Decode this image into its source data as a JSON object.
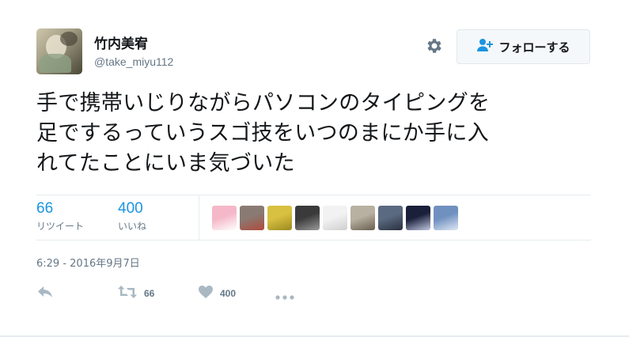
{
  "user": {
    "display_name": "竹内美宥",
    "screen_name": "@take_miyu112"
  },
  "follow_button": {
    "label": "フォローする",
    "icon": "add-user-icon"
  },
  "settings_icon": "gear-icon",
  "tweet": {
    "lines": [
      "手で携帯いじりながらパソコンのタイピングを",
      "足でするっていうスゴ技をいつのまにか手に入",
      "れてたことにいま気づいた"
    ]
  },
  "stats": {
    "retweets": {
      "count": "66",
      "label": "リツイート"
    },
    "likes": {
      "count": "400",
      "label": "いいね"
    }
  },
  "likers": [
    {
      "name": "liker-1",
      "colors": [
        "#f4b8c8",
        "#ffffff"
      ]
    },
    {
      "name": "liker-2",
      "colors": [
        "#8a7a74",
        "#b04a3a"
      ]
    },
    {
      "name": "liker-3",
      "colors": [
        "#d8c040",
        "#9c8a20"
      ]
    },
    {
      "name": "liker-4",
      "colors": [
        "#3a3a3a",
        "#9a9a9a"
      ]
    },
    {
      "name": "liker-5",
      "colors": [
        "#f2f2f2",
        "#cfcfcf"
      ]
    },
    {
      "name": "liker-6",
      "colors": [
        "#b8b0a0",
        "#6a6050"
      ]
    },
    {
      "name": "liker-7",
      "colors": [
        "#5a6a80",
        "#2a3040"
      ]
    },
    {
      "name": "liker-8",
      "colors": [
        "#1a1f3a",
        "#c0c8e0"
      ]
    },
    {
      "name": "liker-9",
      "colors": [
        "#7090c0",
        "#e0e8f4"
      ]
    }
  ],
  "timestamp": "6:29 - 2016年9月7日",
  "actions": {
    "reply_icon": "reply-icon",
    "retweet": {
      "icon": "retweet-icon",
      "count": "66"
    },
    "like": {
      "icon": "heart-icon",
      "count": "400"
    },
    "more_icon": "more-icon"
  },
  "colors": {
    "accent": "#1b95e0",
    "text": "#14171a",
    "muted": "#657786",
    "border": "#e6ecf0",
    "icon": "#aab8c2"
  }
}
